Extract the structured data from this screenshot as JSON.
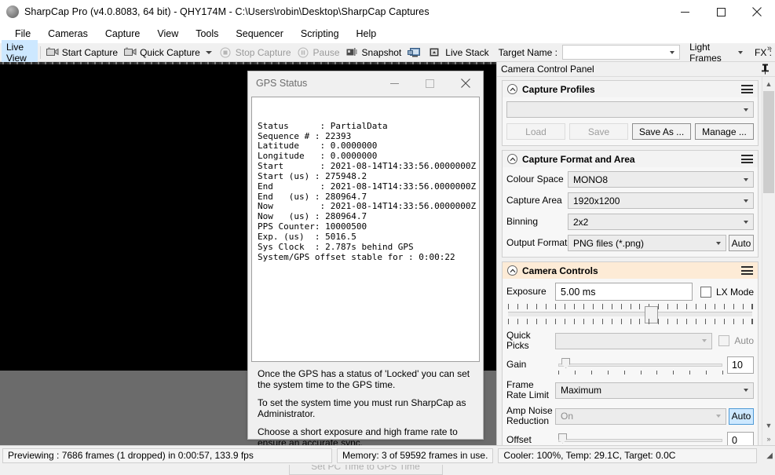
{
  "window": {
    "title": "SharpCap Pro (v4.0.8083, 64 bit) - QHY174M - C:\\Users\\robin\\Desktop\\SharpCap Captures",
    "minimize_label": "Minimize",
    "maximize_label": "Maximize",
    "close_label": "Close"
  },
  "menubar": {
    "items": [
      {
        "label": "File"
      },
      {
        "label": "Cameras"
      },
      {
        "label": "Capture"
      },
      {
        "label": "View"
      },
      {
        "label": "Tools"
      },
      {
        "label": "Sequencer"
      },
      {
        "label": "Scripting"
      },
      {
        "label": "Help"
      }
    ]
  },
  "toolbar": {
    "live_view": "Live View",
    "start_capture": "Start Capture",
    "quick_capture": "Quick Capture",
    "stop_capture": "Stop Capture",
    "pause": "Pause",
    "snapshot": "Snapshot",
    "live_stack": "Live Stack",
    "target_name_label": "Target Name :",
    "target_name_value": "",
    "frame_type_value": "Light Frames",
    "fx_label": "FX :",
    "overflow": "»"
  },
  "camera_control_panel": {
    "header": "Camera Control Panel",
    "pin_icon": "pin-icon",
    "capture_profiles": {
      "title": "Capture Profiles",
      "profile_value": "",
      "buttons": [
        {
          "label": "Load",
          "enabled": false
        },
        {
          "label": "Save",
          "enabled": false
        },
        {
          "label": "Save As ...",
          "enabled": true
        },
        {
          "label": "Manage ...",
          "enabled": true
        }
      ]
    },
    "capture_format": {
      "title": "Capture Format and Area",
      "fields": [
        {
          "label": "Colour Space",
          "value": "MONO8"
        },
        {
          "label": "Capture Area",
          "value": "1920x1200"
        },
        {
          "label": "Binning",
          "value": "2x2"
        },
        {
          "label": "Output Format",
          "value": "PNG files (*.png)",
          "auto": "Auto"
        }
      ]
    },
    "camera_controls": {
      "title": "Camera Controls",
      "exposure_label": "Exposure",
      "exposure_value": "5.00 ms",
      "lx_mode_label": "LX Mode",
      "lx_mode_checked": false,
      "quick_picks_label": "Quick Picks",
      "quick_picks_value": "",
      "quick_picks_auto": "Auto",
      "gain_label": "Gain",
      "gain_value": "10",
      "frame_rate_limit_label": "Frame Rate Limit",
      "frame_rate_limit_value": "Maximum",
      "amp_noise_label": "Amp Noise Reduction",
      "amp_noise_value": "On",
      "amp_noise_auto": "Auto",
      "offset_label": "Offset",
      "offset_value": "0"
    }
  },
  "gps_dialog": {
    "title": "GPS Status",
    "minimize_label": "Minimize",
    "maximize_label": "Maximize",
    "close_label": "Close",
    "status_text": "Status      : PartialData\nSequence # : 22393\nLatitude    : 0.0000000\nLongitude   : 0.0000000\nStart       : 2021-08-14T14:33:56.0000000Z\nStart (us) : 275948.2\nEnd         : 2021-08-14T14:33:56.0000000Z\nEnd   (us) : 280964.7\nNow         : 2021-08-14T14:33:56.0000000Z\nNow   (us) : 280964.7\nPPS Counter: 10000500\nExp. (us)  : 5016.5\nSys Clock  : 2.787s behind GPS\nSystem/GPS offset stable for : 0:00:22",
    "help_paragraph_1": "Once the GPS has a status of 'Locked' you can set the system time to the GPS time.",
    "help_paragraph_2": "To set the system time you must run SharpCap as Administrator.",
    "help_paragraph_3": "Choose a short exposure and high frame rate to ensure an accurate sync.",
    "set_time_button": "Set PC Time to GPS Time",
    "set_time_enabled": false
  },
  "statusbar": {
    "preview_status": "Previewing : 7686 frames (1 dropped) in 0:00:57, 133.9 fps",
    "memory_status": "Memory: 3 of 59592 frames in use.",
    "cooler_status": "Cooler: 100%, Temp: 29.1C, Target: 0.0C",
    "resize_grip": "resize-grip-icon"
  },
  "colors": {
    "accent_selected": "#cde8ff",
    "camera_controls_header": "#fdebd6",
    "panel_bg": "#f0f0f0",
    "preview_bg": "#6b6b6b"
  }
}
